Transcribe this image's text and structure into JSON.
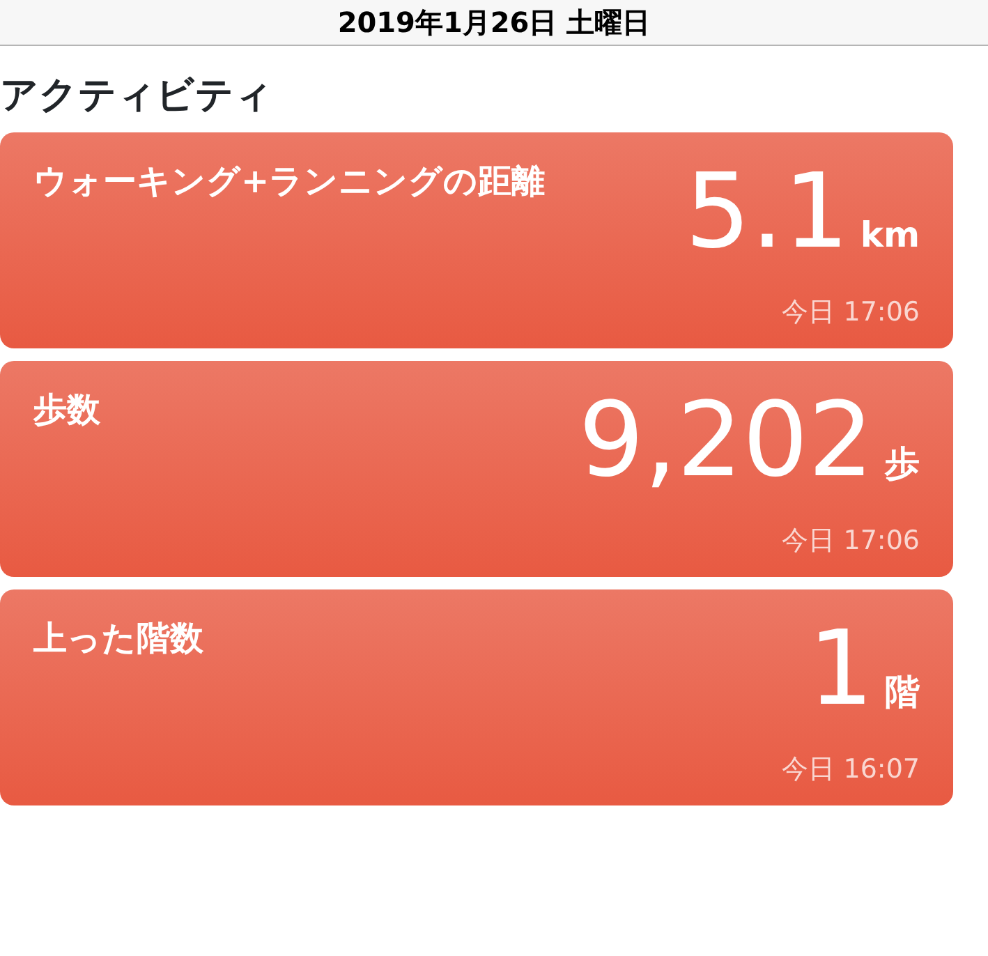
{
  "header": {
    "title": "2019年1月26日 土曜日"
  },
  "section_title": "アクティビティ",
  "cards": [
    {
      "title": "ウォーキング+ランニングの距離",
      "value": "5.1",
      "unit": "km",
      "time": "今日 17:06"
    },
    {
      "title": "歩数",
      "value": "9,202",
      "unit": "歩",
      "time": "今日 17:06"
    },
    {
      "title": "上った階数",
      "value": "1",
      "unit": "階",
      "time": "今日 16:07"
    }
  ]
}
